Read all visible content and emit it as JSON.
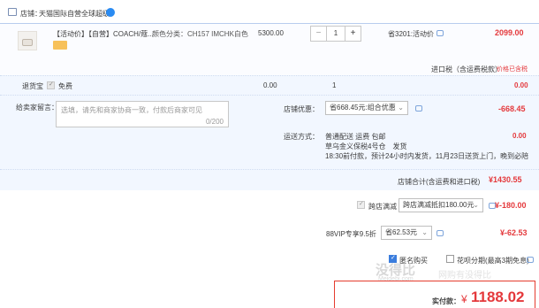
{
  "shop": {
    "label": "店铺：",
    "name": "天猫国际自营全球超级",
    "badge_color": "#2a8bf2"
  },
  "item": {
    "title": "【活动价】【自营】COACH/蔻...",
    "sku": "颜色分类：CH157 IMCHK白色",
    "price": "5300.00",
    "qty": "1",
    "minus": "−",
    "plus": "+",
    "discount": "省3201:活动价",
    "subtotal": "2099.00",
    "tax_note": "进口税（含运费税款）",
    "tax_value": "价格已含税"
  },
  "service": {
    "name": "退货宝",
    "option": "免费",
    "price": "0.00",
    "qty": "1",
    "total": "0.00"
  },
  "message": {
    "label": "给卖家留言：",
    "placeholder": "选填，请先和商家协商一致，付款后商家可见",
    "counter": "0/200"
  },
  "shop_discount": {
    "label": "店铺优惠：",
    "selected": "省668.45元:组合优惠",
    "value": "-668.45"
  },
  "delivery": {
    "label": "运送方式：",
    "line1": "普通配送 运费 包邮",
    "line2": "草乌金义保税4号仓　发货",
    "line3": "18:30前付款，预计24小时内发货，11月23日送货上门，晚到必陪",
    "value": "0.00"
  },
  "shop_total": {
    "label": "店铺合计(含运费和进口税)",
    "value": "¥1430.55"
  },
  "cross_store": {
    "label": "跨店满减",
    "selected": "跨店满减抵扣180.00元",
    "value": "¥-180.00"
  },
  "vip": {
    "label": "88VIP专享9.5折",
    "selected": "省62.53元",
    "value": "¥-62.53"
  },
  "anonymous": {
    "label": "匿名购买",
    "checked": true
  },
  "installment": {
    "label": "花呗分期(最高3期免息)"
  },
  "payment": {
    "label": "实付款：",
    "currency": "¥",
    "amount": "1188.02"
  },
  "watermark": {
    "cn": "没得比",
    "site": "Meidebi.com",
    "slogan": "网购有没得比"
  },
  "colors": {
    "accent_red": "#e4393c",
    "border_blue": "#b8ccee",
    "row_bg": "#f2f7ff"
  }
}
